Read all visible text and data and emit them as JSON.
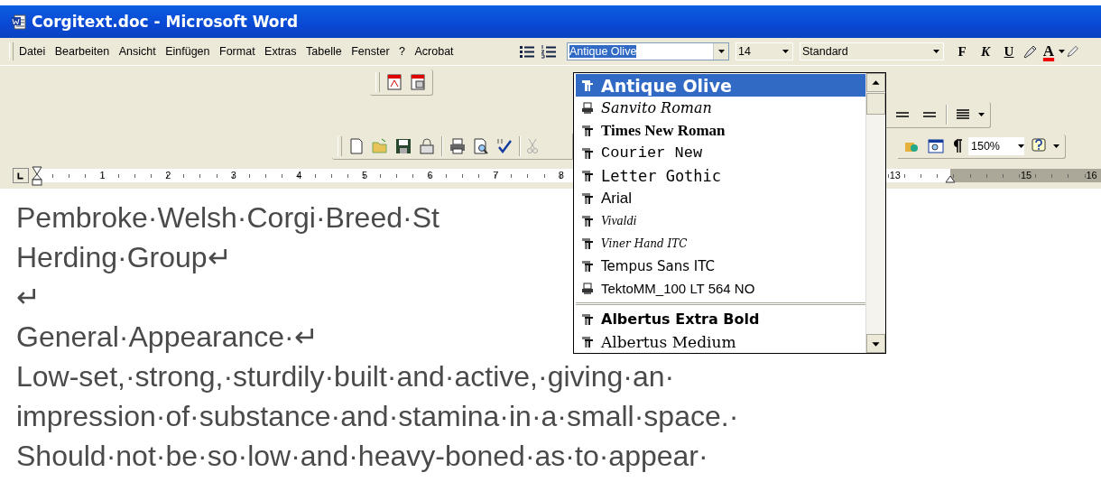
{
  "window": {
    "title": "Corgitext.doc - Microsoft Word"
  },
  "menu_bar": {
    "items": [
      "Datei",
      "Bearbeiten",
      "Ansicht",
      "Einfügen",
      "Format",
      "Extras",
      "Tabelle",
      "Fenster",
      "?",
      "Acrobat"
    ]
  },
  "formatting_toolbar": {
    "font": "Antique Olive",
    "font_size": "14",
    "style": "Standard",
    "bold_label": "F",
    "italic_label": "K",
    "underline_label": "U",
    "font_color_label": "A"
  },
  "standard_toolbar": {
    "zoom": "150%"
  },
  "ruler": {
    "left_numbers": [
      "1",
      "2",
      "3",
      "4",
      "5",
      "6",
      "7",
      "8"
    ],
    "right_numbers": [
      "13",
      "15",
      "16"
    ]
  },
  "document": {
    "lines": [
      "Pembroke·Welsh·Corgi·Breed·St",
      "Herding·Group↵",
      "↵",
      "General·Appearance·↵",
      "Low-set,·strong,·sturdily·built·and·active,·giving·an·",
      "impression·of·substance·and·stamina·in·a·small·space.·",
      "Should·not·be·so·low·and·heavy-boned·as·to·appear·"
    ]
  },
  "font_dropdown": {
    "recent_fonts": [
      {
        "name": "Antique Olive",
        "kind": "truetype",
        "selected": true
      },
      {
        "name": "Sanvito Roman",
        "kind": "printer",
        "selected": false
      },
      {
        "name": "Times New Roman",
        "kind": "truetype",
        "selected": false
      },
      {
        "name": "Courier New",
        "kind": "truetype",
        "selected": false
      },
      {
        "name": "Letter Gothic",
        "kind": "truetype",
        "selected": false
      },
      {
        "name": "Arial",
        "kind": "truetype",
        "selected": false
      },
      {
        "name": "Vivaldi",
        "kind": "truetype",
        "selected": false
      },
      {
        "name": "Viner Hand ITC",
        "kind": "truetype",
        "selected": false
      },
      {
        "name": "Tempus Sans ITC",
        "kind": "truetype",
        "selected": false
      },
      {
        "name": "TektoMM_100 LT 564 NO",
        "kind": "printer",
        "selected": false
      }
    ],
    "all_fonts": [
      {
        "name": "Albertus Extra Bold",
        "kind": "truetype",
        "selected": false
      },
      {
        "name": "Albertus Medium",
        "kind": "truetype",
        "selected": false
      }
    ]
  }
}
